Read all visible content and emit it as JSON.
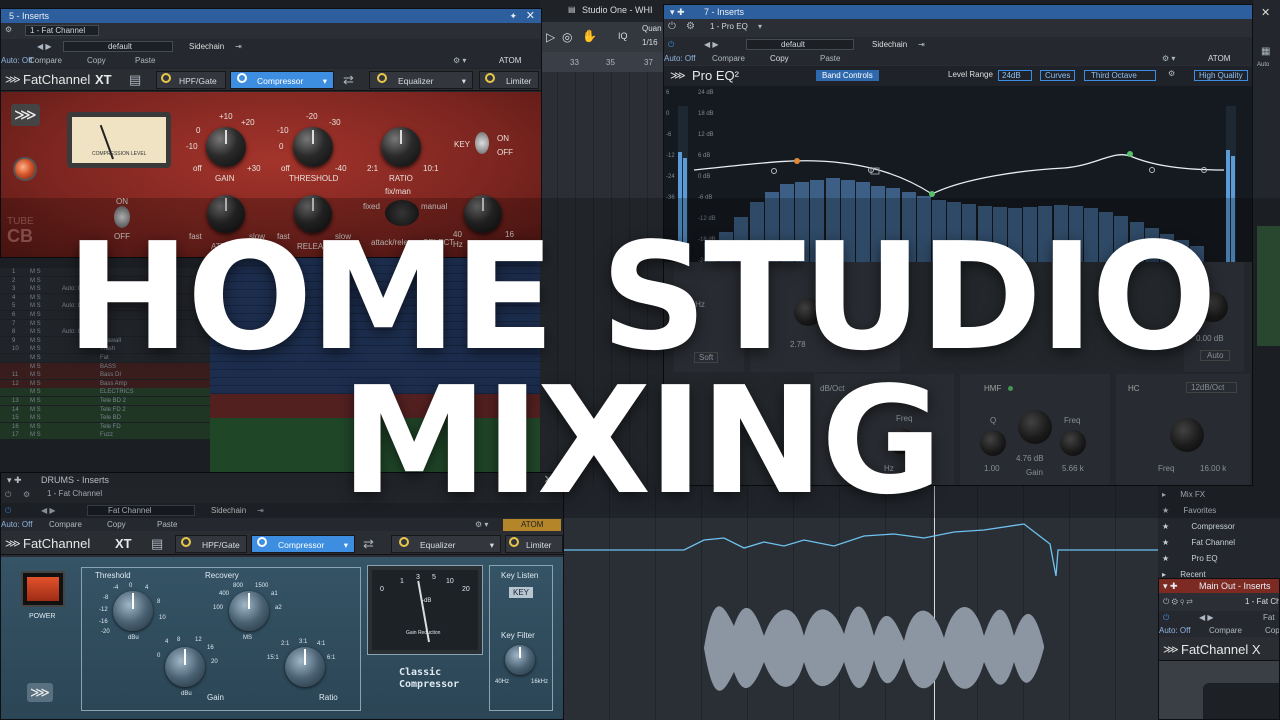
{
  "colors": {
    "accent": "#3d8ee0",
    "fatchannel_red": "#8c2a24",
    "compressor_blue": "#2f4a5c",
    "title_text": "#ffffff"
  },
  "overlay": {
    "line1": "HOME STUDIO",
    "line2": "MIXING"
  },
  "top_left": {
    "title": "5 - Inserts",
    "channel": "1 - Fat Channel",
    "preset": "default",
    "sidechain": "Sidechain",
    "auto": "Auto: Off",
    "compare": "Compare",
    "copy": "Copy",
    "paste": "Paste",
    "atom": "ATOM",
    "plugin_name": "FatChannel",
    "plugin_suffix": "XT",
    "tabs": [
      "HPF/Gate",
      "Compressor",
      "Equalizer",
      "Limiter"
    ],
    "vu_label": "COMPRESSION LEVEL",
    "gain": "GAIN",
    "threshold": "THRESHOLD",
    "ratio": "RATIO",
    "fixman": "fix/man",
    "key": "KEY",
    "on": "ON",
    "off": "OFF",
    "attack": "ATTACK",
    "release": "RELEASE",
    "select": "attack/release SELECT",
    "fixed": "fixed",
    "manual": "manual",
    "fast": "fast",
    "slow": "slow",
    "gain_scale": [
      "+10",
      "+20",
      "0",
      "-10",
      "off",
      "+30"
    ],
    "thr_scale": [
      "-20",
      "-30",
      "-10",
      "0",
      "off",
      "-40"
    ],
    "ratio_scale": [
      "2:1",
      "10:1"
    ],
    "tube": "TUBE",
    "cb": "CB",
    "power_on": "ON",
    "power_off": "OFF",
    "hpf40": "40",
    "hz": "Hz",
    "khz16": "16",
    "khz": "kHz"
  },
  "arranger": {
    "title": "Studio One - WHI",
    "quant": "Quan",
    "quant_val": "1/16",
    "bars": [
      "33",
      "35",
      "37"
    ],
    "tracks": [
      {
        "n": "1",
        "name": ""
      },
      {
        "n": "2",
        "name": ""
      },
      {
        "n": "3",
        "name": "Auto: Off"
      },
      {
        "n": "4",
        "name": ""
      },
      {
        "n": "5",
        "name": "Auto: Off"
      },
      {
        "n": "6",
        "name": ""
      },
      {
        "n": "7",
        "name": ""
      },
      {
        "n": "8",
        "name": "Auto: Off"
      },
      {
        "n": "9",
        "name": "Seawall"
      },
      {
        "n": "10",
        "name": "Trash"
      },
      {
        "n": "",
        "name": "Fat"
      },
      {
        "n": "",
        "name": "BASS"
      },
      {
        "n": "11",
        "name": "Bass DI"
      },
      {
        "n": "12",
        "name": "Bass Amp"
      },
      {
        "n": "",
        "name": "ELECTRICS"
      },
      {
        "n": "13",
        "name": "Tele BD 2"
      },
      {
        "n": "14",
        "name": "Tele FD 2"
      },
      {
        "n": "15",
        "name": "Tele BD"
      },
      {
        "n": "16",
        "name": "Tele FD"
      },
      {
        "n": "17",
        "name": "Fuzz"
      }
    ]
  },
  "top_right": {
    "title": "7 - Inserts",
    "channel": "1 - Pro EQ",
    "preset": "default",
    "sidechain": "Sidechain",
    "auto": "Auto: Off",
    "compare": "Compare",
    "copy": "Copy",
    "paste": "Paste",
    "atom": "ATOM",
    "plugin": "Pro EQ²",
    "band_controls": "Band Controls",
    "level_range_label": "Level Range",
    "level_range": "24dB",
    "curves": "Curves",
    "third_octave": "Third Octave",
    "high_quality": "High Quality",
    "db_scale": [
      "24 dB",
      "18 dB",
      "12 dB",
      "6 dB",
      "0 dB",
      "-6 dB",
      "-12 dB",
      "-18 dB",
      "-24 dB"
    ],
    "left_scale": [
      "6",
      "0",
      "-6",
      "-12",
      "-24",
      "-36"
    ],
    "hmf": "HMF",
    "hc": "HC",
    "q": "Q",
    "gain_lbl": "Gain",
    "freq": "Freq",
    "hmf_q": "1.00",
    "hmf_gain": "4.76 dB",
    "hmf_freq": "5.66 k",
    "hc_slope": "12dB/Oct",
    "hc_freq": "16.00 k",
    "gain_right": "0.00 dB",
    "auto_btn": "Auto",
    "partial_gain": "2.78",
    "partial_freq": "80 Hz",
    "soft": "Soft",
    "hz_small": "Hz",
    "freq_partial": "Freq",
    "db_oct": "dB/Oct",
    "gain_small": "Gain"
  },
  "browser": {
    "items": [
      "Mix FX",
      "Favorites",
      "Compressor",
      "Fat Channel",
      "Pro EQ",
      "Recent"
    ]
  },
  "bottom_left": {
    "title": "DRUMS - Inserts",
    "channel": "1 - Fat Channel",
    "preset": "Fat Channel",
    "sidechain": "Sidechain",
    "auto": "Auto: Off",
    "compare": "Compare",
    "copy": "Copy",
    "paste": "Paste",
    "atom": "ATOM",
    "plugin_name": "FatChannel",
    "plugin_suffix": "XT",
    "tabs": [
      "HPF/Gate",
      "Compressor",
      "Equalizer",
      "Limiter"
    ],
    "power": "POWER",
    "threshold": "Threshold",
    "recovery": "Recovery",
    "gain": "Gain",
    "ratio": "Ratio",
    "key_listen": "Key Listen",
    "key": "KEY",
    "key_filter": "Key Filter",
    "classic1": "Classic",
    "classic2": "Compressor",
    "gain_reduction": "Gain Reduction",
    "db": "-dB",
    "vu_scale": [
      "0",
      "1",
      "3",
      "5",
      "10",
      "20"
    ],
    "thr_scale": [
      "0",
      "-4",
      "-8",
      "-12",
      "-16",
      "-20",
      "4",
      "8",
      "10"
    ],
    "rec_scale": [
      "800",
      "1500",
      "400",
      "a1",
      "100",
      "a2",
      "MS"
    ],
    "gain_scale": [
      "4",
      "8",
      "12",
      "16",
      "0",
      "20",
      "dBu"
    ],
    "ratio_scale": [
      "3:1",
      "2:1",
      "4:1",
      "15:1",
      "6:1"
    ],
    "kf_lo": "40Hz",
    "kf_hi": "16kHz",
    "dbu": "dBu"
  },
  "bottom_right": {
    "title": "Main Out - Inserts",
    "channel": "1 - Fat Ch",
    "auto": "Auto: Off",
    "compare": "Compare",
    "copy": "Cop",
    "plugin_name": "FatChannel X",
    "fat": "Fat"
  }
}
